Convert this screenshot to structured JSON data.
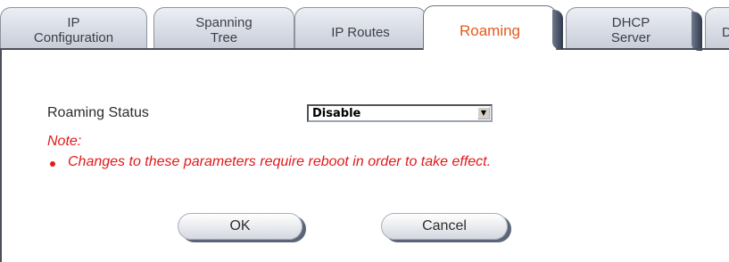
{
  "tabs": [
    {
      "label_line1": "IP",
      "label_line2": "Configuration"
    },
    {
      "label_line1": "Spanning",
      "label_line2": "Tree"
    },
    {
      "label_line1": "IP Routes",
      "label_line2": ""
    },
    {
      "label_line1": "Roaming",
      "label_line2": ""
    },
    {
      "label_line1": "DHCP",
      "label_line2": "Server"
    },
    {
      "label_line1": "DH",
      "label_line2": ""
    }
  ],
  "active_tab": "Roaming",
  "form": {
    "roaming_status_label": "Roaming Status",
    "roaming_status_value": "Disable"
  },
  "note": {
    "heading": "Note:",
    "text": "Changes to these parameters require reboot in order to take effect."
  },
  "buttons": {
    "ok": "OK",
    "cancel": "Cancel"
  },
  "colors": {
    "active_tab_text": "#e8571c",
    "note_text": "#e01a1a"
  }
}
